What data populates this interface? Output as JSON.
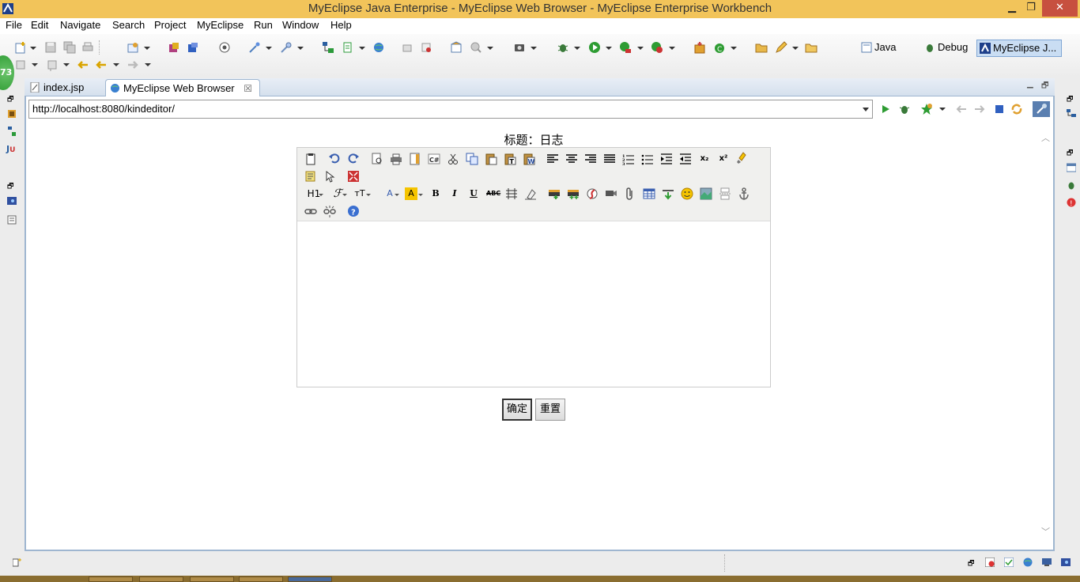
{
  "window": {
    "title": "MyEclipse Java Enterprise - MyEclipse Web Browser - MyEclipse Enterprise Workbench",
    "minimize_glyph": "▁",
    "maximize_glyph": "❐",
    "close_glyph": "✕"
  },
  "menu": {
    "items": [
      "File",
      "Edit",
      "Navigate",
      "Search",
      "Project",
      "MyEclipse",
      "Run",
      "Window",
      "Help"
    ]
  },
  "perspectives": {
    "java": "Java",
    "debug": "Debug",
    "myeclipse": "MyEclipse J..."
  },
  "notification_badge": "73",
  "tabs": {
    "items": [
      {
        "label": "index.jsp",
        "icon": "jsp-file-icon"
      },
      {
        "label": "MyEclipse Web Browser",
        "icon": "globe-icon",
        "close": "☒"
      }
    ]
  },
  "browser": {
    "url": "http://localhost:8080/kindeditor/"
  },
  "page": {
    "title": "标题：日志",
    "submit_label": "确定",
    "reset_label": "重置"
  },
  "editor": {
    "text_labels": {
      "heading": "H1",
      "bold": "B",
      "italic": "I",
      "underline": "U",
      "strike": "ABC",
      "subscript": "x₂",
      "superscript": "x²",
      "fontname": "ℱ",
      "fontsize": "тT",
      "forecolor": "A",
      "hilitecolor": "A"
    },
    "body_text": ""
  },
  "colors": {
    "titlebar": "#f2c45a",
    "close_button": "#c7503f",
    "active_tab_border": "#9fb6d0",
    "badge": "#2e9c33",
    "highlight_yellow": "#f5c400"
  }
}
